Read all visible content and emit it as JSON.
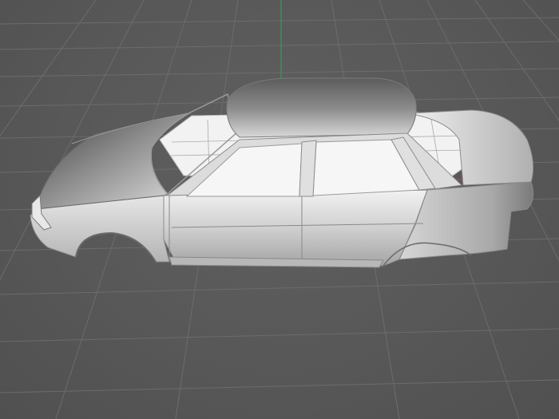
{
  "viewport": {
    "background_color": "#5a5a5a",
    "grid_color": "#6e6e6e",
    "axis_x_color": "#b84a4a",
    "axis_y_color": "#3aa34a"
  },
  "model": {
    "name": "car-body-shell",
    "primary_color": "#c8c8c8",
    "shadow_color": "#4a4a4a",
    "highlight_color": "#f4f4f4"
  }
}
